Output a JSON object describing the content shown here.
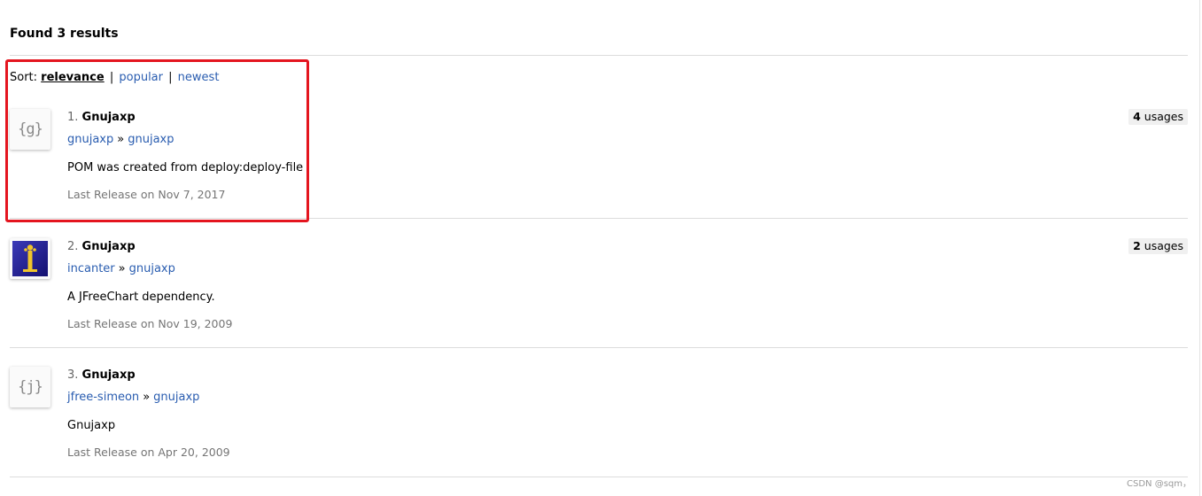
{
  "header": {
    "title": "Found 3 results"
  },
  "sort": {
    "label": "Sort:",
    "options": [
      {
        "label": "relevance",
        "active": true
      },
      {
        "label": "popular",
        "active": false
      },
      {
        "label": "newest",
        "active": false
      }
    ],
    "separator": "|"
  },
  "results": [
    {
      "rank": "1.",
      "name": "Gnujaxp",
      "icon": {
        "type": "text",
        "text": "{g}",
        "name": "group-letter-g-icon"
      },
      "group": "gnujaxp",
      "arrow": "»",
      "artifact": "gnujaxp",
      "description": "POM was created from deploy:deploy-file",
      "release": "Last Release on Nov 7, 2017",
      "usages_count": "4",
      "usages_label": "usages"
    },
    {
      "rank": "2.",
      "name": "Gnujaxp",
      "icon": {
        "type": "image",
        "name": "incanter-logo-icon"
      },
      "group": "incanter",
      "arrow": "»",
      "artifact": "gnujaxp",
      "description": "A JFreeChart dependency.",
      "release": "Last Release on Nov 19, 2009",
      "usages_count": "2",
      "usages_label": "usages"
    },
    {
      "rank": "3.",
      "name": "Gnujaxp",
      "icon": {
        "type": "text",
        "text": "{j}",
        "name": "group-letter-j-icon"
      },
      "group": "jfree-simeon",
      "arrow": "»",
      "artifact": "gnujaxp",
      "description": "Gnujaxp",
      "release": "Last Release on Apr 20, 2009",
      "usages_count": "",
      "usages_label": ""
    }
  ],
  "watermark": "CSDN @sqm，",
  "colors": {
    "link": "#2a5db0",
    "highlight": "#e4151f",
    "divider": "#dcdcdc"
  }
}
